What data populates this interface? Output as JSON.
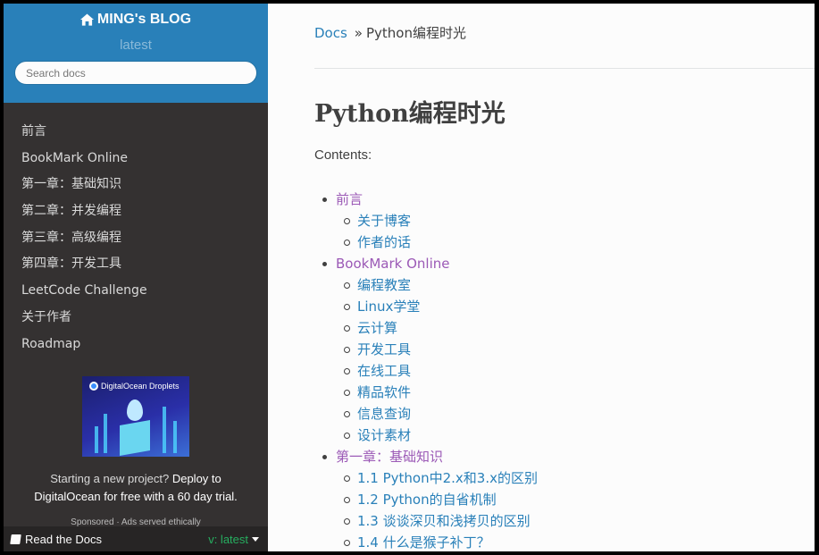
{
  "sidebar": {
    "brand": "MING's BLOG",
    "version": "latest",
    "search_placeholder": "Search docs",
    "nav_items": [
      {
        "label": "前言"
      },
      {
        "label": "BookMark Online"
      },
      {
        "label": "第一章：基础知识"
      },
      {
        "label": "第二章：并发编程"
      },
      {
        "label": "第三章：高级编程"
      },
      {
        "label": "第四章：开发工具"
      },
      {
        "label": "LeetCode Challenge"
      },
      {
        "label": "关于作者"
      },
      {
        "label": "Roadmap"
      }
    ],
    "ad": {
      "image_title": "DigitalOcean Droplets",
      "text_plain": "Starting a new project? ",
      "text_bold": "Deploy to DigitalOcean for free with a 60 day trial.",
      "sponsor": "Sponsored · Ads served ethically"
    },
    "footer": {
      "left_label": "Read the Docs",
      "right_label": "v: latest"
    }
  },
  "breadcrumb": {
    "root": "Docs",
    "separator": "»",
    "current": "Python编程时光"
  },
  "page": {
    "title": "Python编程时光",
    "contents_label": "Contents:"
  },
  "toc": [
    {
      "level": 1,
      "label": "前言"
    },
    {
      "level": 2,
      "label": "关于博客"
    },
    {
      "level": 2,
      "label": "作者的话"
    },
    {
      "level": 1,
      "label": "BookMark Online"
    },
    {
      "level": 2,
      "label": "编程教室"
    },
    {
      "level": 2,
      "label": "Linux学堂"
    },
    {
      "level": 2,
      "label": "云计算"
    },
    {
      "level": 2,
      "label": "开发工具"
    },
    {
      "level": 2,
      "label": "在线工具"
    },
    {
      "level": 2,
      "label": "精品软件"
    },
    {
      "level": 2,
      "label": "信息查询"
    },
    {
      "level": 2,
      "label": "设计素材"
    },
    {
      "level": 1,
      "label": "第一章：基础知识"
    },
    {
      "level": 2,
      "label": "1.1 Python中2.x和3.x的区别"
    },
    {
      "level": 2,
      "label": "1.2 Python的自省机制"
    },
    {
      "level": 2,
      "label": "1.3 谈谈深贝和浅拷贝的区别"
    },
    {
      "level": 2,
      "label": "1.4 什么是猴子补丁？"
    }
  ],
  "colors": {
    "sidebar_top": "#2980b9",
    "sidebar_bg": "#343131",
    "link": "#2980b9",
    "visited_link": "#9b59b6",
    "version_green": "#27ae60"
  }
}
